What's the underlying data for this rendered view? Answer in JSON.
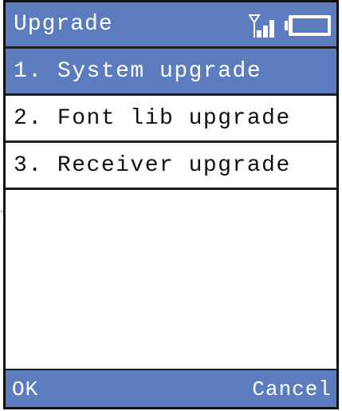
{
  "titlebar": {
    "title": "Upgrade",
    "signal_icon": "signal-strength-icon",
    "battery_icon": "battery-icon"
  },
  "menu": {
    "items": [
      {
        "label": "1. System upgrade",
        "selected": true
      },
      {
        "label": "2. Font lib upgrade",
        "selected": false
      },
      {
        "label": "3. Receiver upgrade",
        "selected": false
      }
    ]
  },
  "softkeys": {
    "left": "OK",
    "right": "Cancel"
  },
  "colors": {
    "accent": "#5b7dbf",
    "border": "#1d1d1d",
    "background": "#ffffff"
  }
}
